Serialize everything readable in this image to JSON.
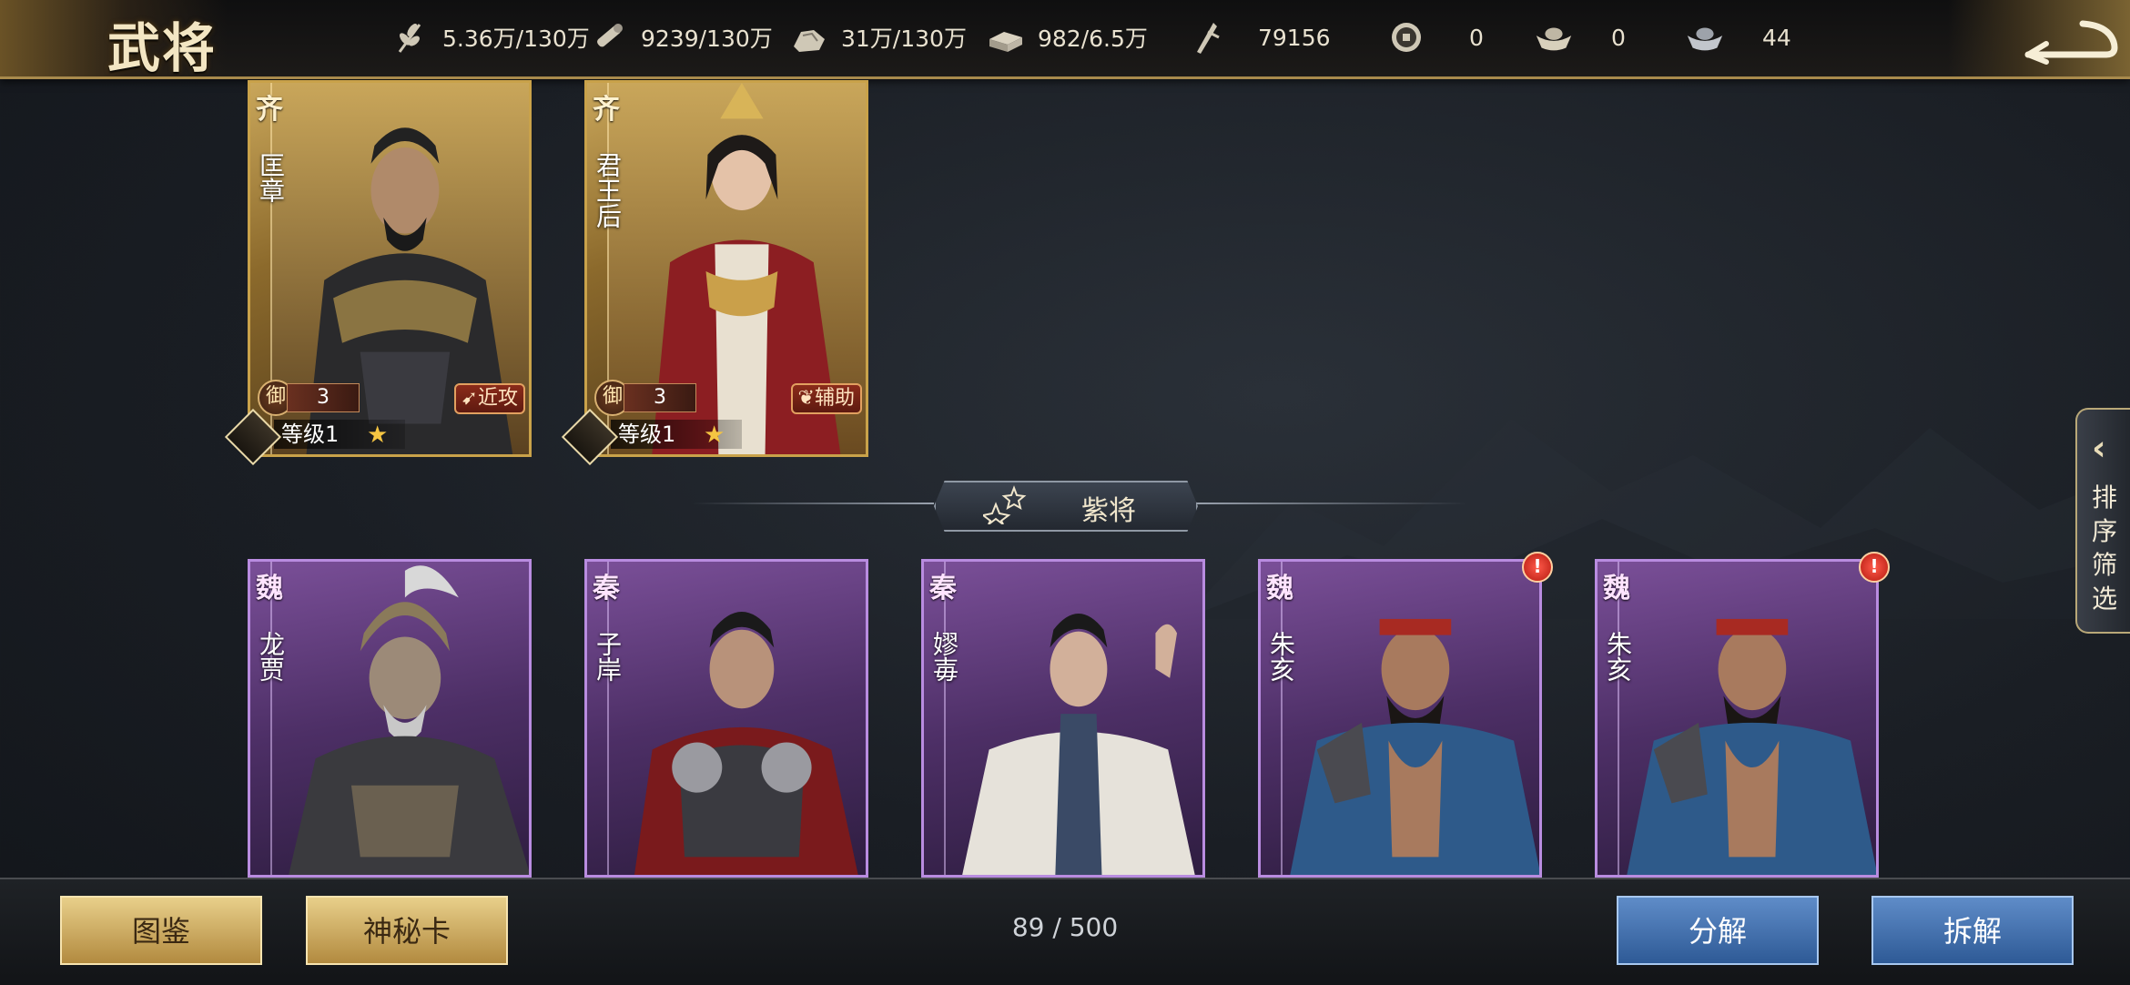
{
  "header": {
    "title": "武将",
    "resources": [
      {
        "icon": "grain-icon",
        "value": "5.36万/130万"
      },
      {
        "icon": "wood-icon",
        "value": "9239/130万"
      },
      {
        "icon": "stone-icon",
        "value": "31万/130万"
      },
      {
        "icon": "iron-icon",
        "value": "982/6.5万"
      },
      {
        "icon": "order-token-icon",
        "value": "79156"
      },
      {
        "icon": "coin-icon",
        "value": "0"
      },
      {
        "icon": "gold-ingot-icon",
        "value": "0"
      },
      {
        "icon": "silver-ingot-icon",
        "value": "44"
      }
    ]
  },
  "gold_cards": [
    {
      "kingdom": "齐",
      "name": "匡章",
      "stat_label": "御",
      "stat_value": "3",
      "role": "近攻",
      "level": "等级1"
    },
    {
      "kingdom": "齐",
      "name": "君王后",
      "stat_label": "御",
      "stat_value": "3",
      "role": "辅助",
      "level": "等级1"
    }
  ],
  "section": {
    "title": "紫将"
  },
  "purple_cards": [
    {
      "kingdom": "魏",
      "name": "龙贾",
      "alert": false
    },
    {
      "kingdom": "秦",
      "name": "子岸",
      "alert": false
    },
    {
      "kingdom": "秦",
      "name": "嫪毐",
      "alert": false
    },
    {
      "kingdom": "魏",
      "name": "朱亥",
      "alert": true
    },
    {
      "kingdom": "魏",
      "name": "朱亥",
      "alert": true
    }
  ],
  "side_tab": {
    "label": "排序筛选"
  },
  "footer": {
    "codex_label": "图鉴",
    "mystery_card_label": "神秘卡",
    "count": "89 / 500",
    "decompose_label": "分解",
    "dismantle_label": "拆解",
    "alert_mark": "!"
  },
  "colors": {
    "gold_frame": "#c9a24a",
    "purple_frame": "#b98ce0",
    "button_gold": "#d4b068",
    "button_blue": "#4a78b4"
  }
}
